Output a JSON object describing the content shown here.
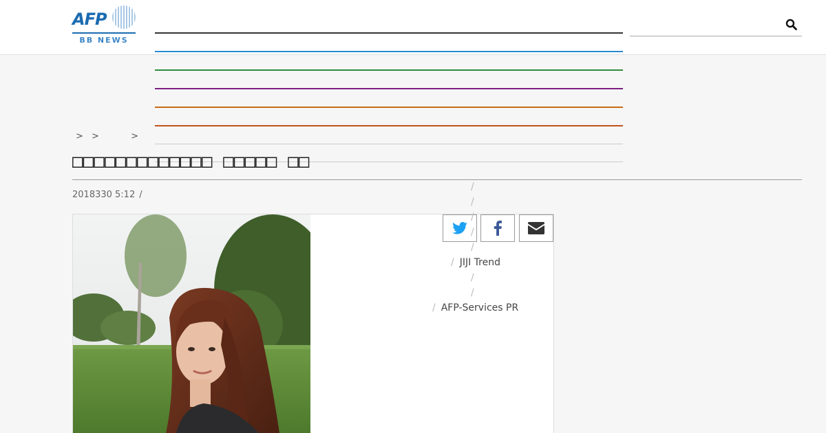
{
  "header": {
    "logo": {
      "wordmark": "AFP",
      "subtitle": "BB NEWS"
    },
    "nav_lines": [
      {
        "color": "#333333"
      },
      {
        "color": "#2a8ad1"
      },
      {
        "color": "#2e8b3e"
      },
      {
        "color": "#7a1e82"
      },
      {
        "color": "#c76a12"
      },
      {
        "color": "#c0521a"
      },
      {
        "color": "#cccccc"
      },
      {
        "color": "#cccccc"
      }
    ],
    "search_icon": "search-icon"
  },
  "breadcrumb": {
    "items": [
      ">",
      ">",
      ">"
    ]
  },
  "article": {
    "title": "□□□□□□□□□□□□□ □□□□□ □□",
    "timestamp": "2018330 5:12",
    "meta_separator": "/"
  },
  "share": {
    "buttons": [
      {
        "icon": "twitter-icon"
      },
      {
        "icon": "facebook-icon"
      },
      {
        "icon": "mail-icon"
      }
    ]
  },
  "related": {
    "separator": "/",
    "items": [
      "",
      "",
      "",
      "",
      "",
      "JIJI Trend",
      "",
      "",
      "AFP-Services PR"
    ]
  },
  "colors": {
    "brand": "#1c6bb0",
    "twitter": "#1da1f2",
    "facebook": "#3b5998",
    "mail": "#333333"
  }
}
